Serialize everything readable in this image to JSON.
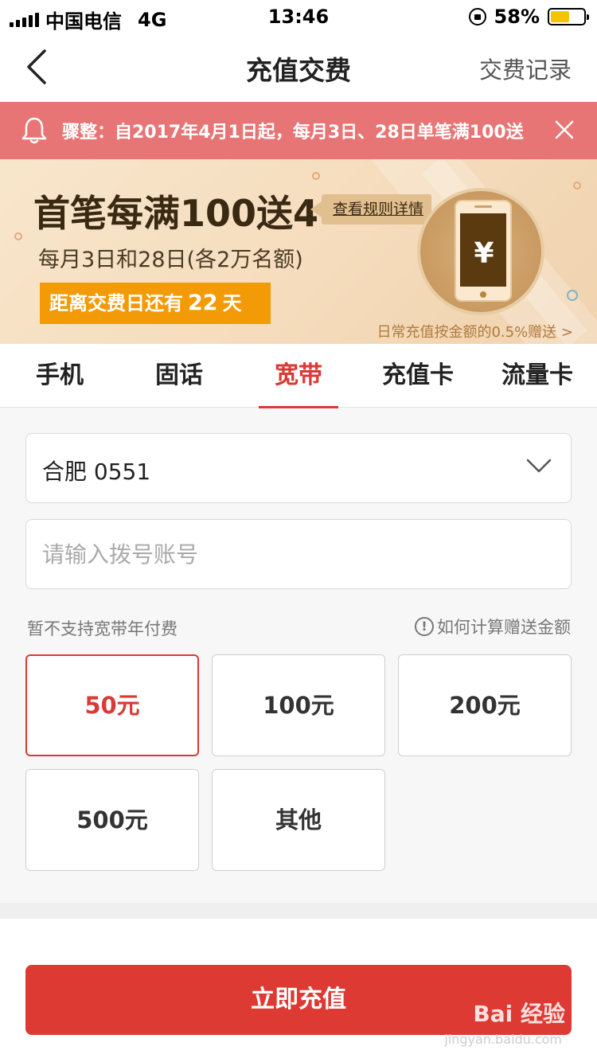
{
  "status_bar": {
    "carrier": "中国电信",
    "network": "4G",
    "time": "13:46",
    "battery_percent": "58%",
    "battery_level": 0.58
  },
  "nav": {
    "back_icon": "chevron-left-icon",
    "title": "充值交费",
    "right_link": "交费记录"
  },
  "notice": {
    "icon": "bell-icon",
    "text": "骤整：自2017年4月1日起，每月3日、28日单笔满100送",
    "close_icon": "close-icon"
  },
  "banner": {
    "title": "首笔每满100送4",
    "rules_link": "查看规则详情",
    "subtitle": "每月3日和28日(各2万名额)",
    "countdown_prefix": "距离交费日还有",
    "countdown_days": "22",
    "countdown_unit": "天",
    "coin_symbol": "¥",
    "footer": "日常充值按金额的0.5%赠送 >",
    "accent": "#f39a07"
  },
  "tabs": [
    {
      "label": "手机",
      "active": false
    },
    {
      "label": "固话",
      "active": false
    },
    {
      "label": "宽带",
      "active": true
    },
    {
      "label": "充值卡",
      "active": false
    },
    {
      "label": "流量卡",
      "active": false
    }
  ],
  "form": {
    "city_value": "合肥 0551",
    "account_placeholder": "请输入拨号账号",
    "account_value": "",
    "hint_left": "暂不支持宽带年付费",
    "hint_right": "如何计算赠送金额",
    "info_glyph": "!"
  },
  "amounts": [
    {
      "label": "50元",
      "selected": true
    },
    {
      "label": "100元",
      "selected": false
    },
    {
      "label": "200元",
      "selected": false
    },
    {
      "label": "500元",
      "selected": false
    },
    {
      "label": "其他",
      "selected": false
    }
  ],
  "submit_label": "立即充值",
  "watermark": {
    "text": "Bai 经验",
    "sub": "jingyan.baidu.com"
  },
  "colors": {
    "primary_red": "#dd3a34",
    "notice_bg": "#e87575",
    "tab_active": "#d93a36"
  }
}
